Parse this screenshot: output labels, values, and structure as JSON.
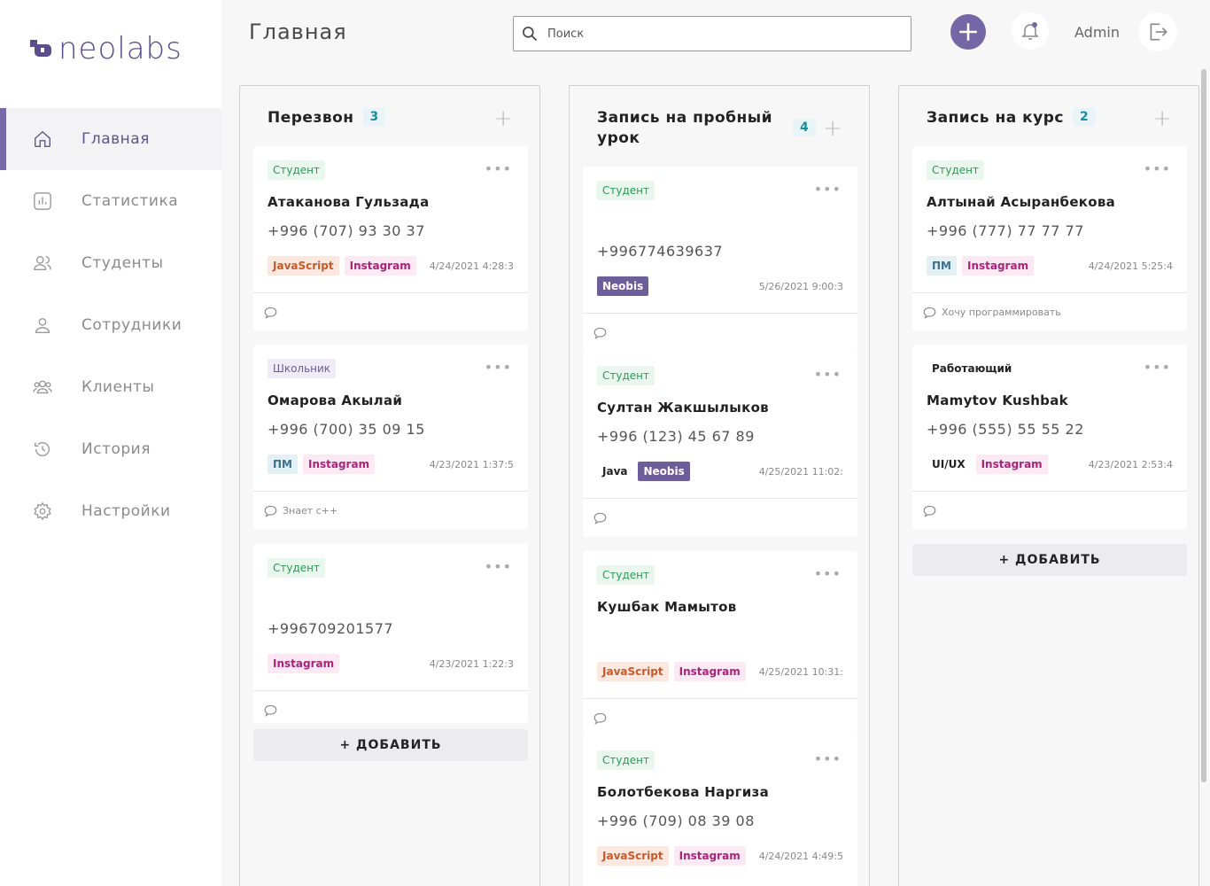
{
  "brand": {
    "logo_text": "neolabs"
  },
  "sidebar": {
    "items": [
      {
        "label": "Главная",
        "icon": "home-icon",
        "active": true
      },
      {
        "label": "Статистика",
        "icon": "stats-icon",
        "active": false
      },
      {
        "label": "Студенты",
        "icon": "students-icon",
        "active": false
      },
      {
        "label": "Сотрудники",
        "icon": "employee-icon",
        "active": false
      },
      {
        "label": "Клиенты",
        "icon": "clients-icon",
        "active": false
      },
      {
        "label": "История",
        "icon": "history-icon",
        "active": false
      },
      {
        "label": "Настройки",
        "icon": "settings-icon",
        "active": false
      }
    ]
  },
  "header": {
    "title": "Главная",
    "search_placeholder": "Поиск",
    "user": "Admin"
  },
  "columns": [
    {
      "title": "Перезвон",
      "count": "3",
      "add_label": "+ ДОБАВИТЬ",
      "cards": [
        {
          "badge": "Студент",
          "name": "Атаканова Гульзада",
          "phone": "+996 (707) 93 30 37",
          "tags": [
            "JavaScript",
            "Instagram"
          ],
          "date": "4/24/2021 4:28:3",
          "comment": ""
        },
        {
          "badge": "Школьник",
          "name": "Омарова Акылай",
          "phone": "+996 (700) 35 09 15",
          "tags": [
            "ПМ",
            "Instagram"
          ],
          "date": "4/23/2021 1:37:5",
          "comment": "Знает с++"
        },
        {
          "badge": "Студент",
          "name": "",
          "phone": "+996709201577",
          "tags": [
            "Instagram"
          ],
          "date": "4/23/2021 1:22:3",
          "comment": ""
        }
      ]
    },
    {
      "title": "Запись на пробный урок",
      "count": "4",
      "cards": [
        {
          "badge": "Студент",
          "name": "",
          "phone": "+996774639637",
          "tags": [
            "Neobis"
          ],
          "date": "5/26/2021 9:00:3",
          "comment": ""
        },
        {
          "badge": "Студент",
          "name": "Султан Жакшылыков",
          "phone": "+996 (123) 45 67 89",
          "tags": [
            "Java",
            "Neobis"
          ],
          "date": "4/25/2021 11:02:",
          "comment": ""
        },
        {
          "badge": "Студент",
          "name": "Кушбак Мамытов",
          "phone": "",
          "tags": [
            "JavaScript",
            "Instagram"
          ],
          "date": "4/25/2021 10:31:",
          "comment": ""
        },
        {
          "badge": "Студент",
          "name": "Болотбекова Наргиза",
          "phone": "+996 (709) 08 39 08",
          "tags": [
            "JavaScript",
            "Instagram"
          ],
          "date": "4/24/2021 4:49:5",
          "comment": ""
        }
      ]
    },
    {
      "title": "Запись на курс",
      "count": "2",
      "add_label": "+ ДОБАВИТЬ",
      "cards": [
        {
          "badge": "Студент",
          "name": "Алтынай Асыранбекова",
          "phone": "+996 (777) 77 77 77",
          "tags": [
            "ПМ",
            "Instagram"
          ],
          "date": "4/24/2021 5:25:4",
          "comment": "Хочу программировать"
        },
        {
          "badge": "Работающий",
          "name": "Mamytov Kushbak",
          "phone": "+996 (555) 55 55 22",
          "tags": [
            "UI/UX",
            "Instagram"
          ],
          "date": "4/23/2021 2:53:4",
          "comment": ""
        }
      ]
    }
  ],
  "colors": {
    "accent": "#7467a6",
    "active_text": "#5e5487"
  }
}
